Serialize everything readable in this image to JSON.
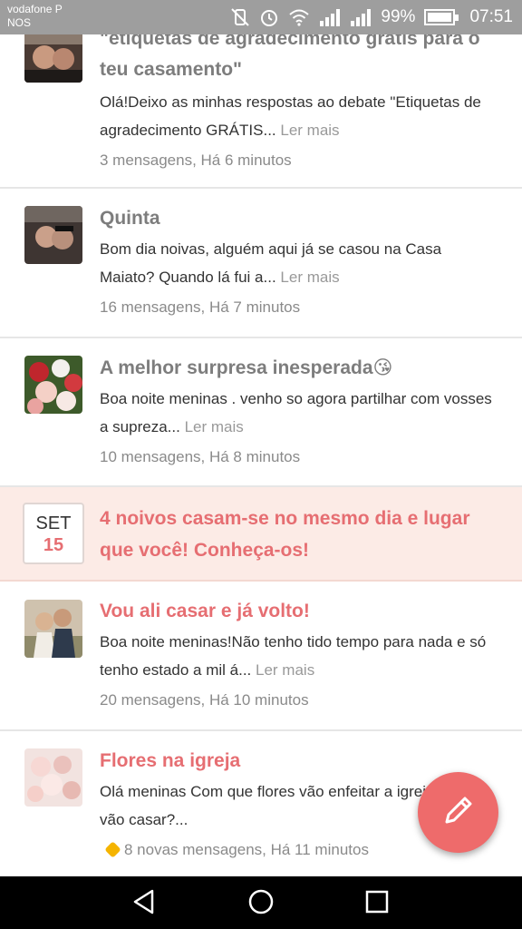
{
  "status_bar": {
    "carrier_line1": "vodafone P",
    "carrier_line2": "NOS",
    "battery_percent": "99%",
    "time": "07:51"
  },
  "feed": [
    {
      "title": "\"etiquetas de agradecimento grátis para o teu casamento\"",
      "snippet": "Olá!Deixo as minhas respostas ao debate \"Etiquetas de agradecimento GRÁTIS...",
      "more": "Ler mais",
      "meta": "3 mensagens, Há 6 minutos"
    },
    {
      "title": "Quinta",
      "snippet": "Bom dia noivas, alguém aqui já se casou na Casa Maiato? Quando lá fui a...",
      "more": "Ler mais",
      "meta": "16 mensagens, Há 7 minutos"
    },
    {
      "title": "A melhor surpresa inesperada",
      "title_emoji": "😘",
      "snippet": "Boa noite meninas . venho so agora partilhar com vosses a supreza...",
      "more": "Ler mais",
      "meta": "10 mensagens, Há 8 minutos"
    },
    {
      "title": "Vou ali casar e já volto!",
      "snippet": "Boa noite meninas!Não tenho tido tempo para nada e só tenho estado a mil á...",
      "more": "Ler mais",
      "meta": "20 mensagens, Há 10 minutos"
    },
    {
      "title": "Flores na igreja",
      "snippet": "Olá meninas Com que flores vão enfeitar a igreja onde vão casar?...",
      "meta": "8 novas mensagens, Há 11 minutos"
    }
  ],
  "promo": {
    "month": "SET",
    "day": "15",
    "title": "4 noivos casam-se no mesmo dia e lugar que você! Conheça-os!"
  },
  "colors": {
    "accent": "#e66e72",
    "fab": "#ee6b6b",
    "promo_bg": "#fcebe6",
    "new_badge": "#f5b400"
  },
  "icons": {
    "fab": "pencil-icon",
    "nav": [
      "back-icon",
      "home-icon",
      "recents-icon"
    ]
  }
}
